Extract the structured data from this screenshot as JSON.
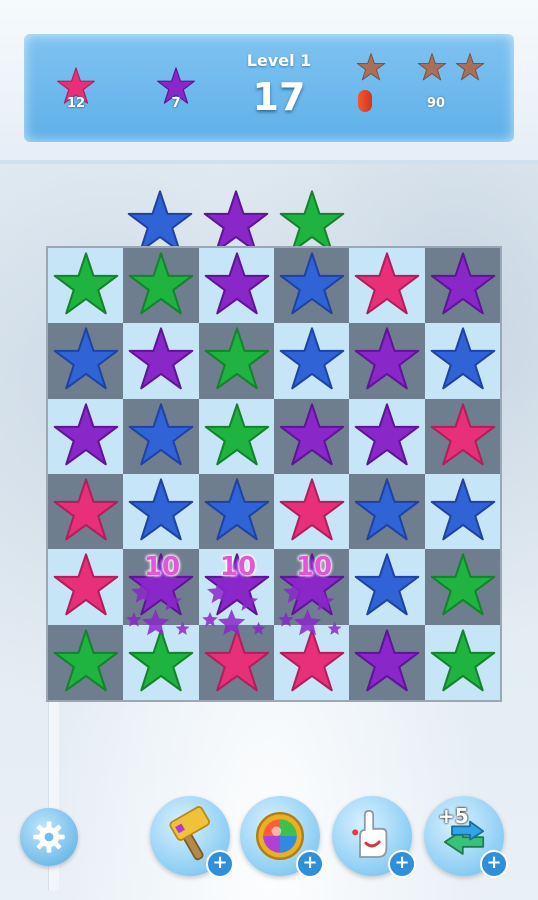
{
  "hud": {
    "level_label": "Level 1",
    "moves_left": "17",
    "score": "90",
    "goals": [
      {
        "icon": "pink-star-goal-icon",
        "color": "#e8307a",
        "count": "12"
      },
      {
        "icon": "purple-star-goal-icon",
        "color": "#8a27c9",
        "count": "7"
      }
    ],
    "rating_stars_earned": 0,
    "rating_stars_total": 3
  },
  "colors": {
    "pink": "#e8307a",
    "purple": "#8a27c9",
    "green": "#1fb33f",
    "blue": "#2f63d6",
    "rating_star": "#a8705a"
  },
  "incoming": [
    "blue",
    "purple",
    "green"
  ],
  "board": [
    [
      "green",
      "green",
      "purple",
      "blue",
      "pink",
      "purple"
    ],
    [
      "blue",
      "purple",
      "green",
      "blue",
      "purple",
      "blue"
    ],
    [
      "purple",
      "blue",
      "green",
      "purple",
      "purple",
      "pink"
    ],
    [
      "pink",
      "blue",
      "blue",
      "pink",
      "blue",
      "blue"
    ],
    [
      "pink",
      "purple",
      "purple",
      "purple",
      "blue",
      "green"
    ],
    [
      "green",
      "green",
      "pink",
      "pink",
      "purple",
      "green"
    ]
  ],
  "combo_points": [
    "10",
    "10",
    "10"
  ],
  "boosters": [
    {
      "name": "hammer-booster-icon"
    },
    {
      "name": "rainbow-ball-booster-icon"
    },
    {
      "name": "glove-booster-icon"
    },
    {
      "name": "extra-moves-booster-icon",
      "label": "+5"
    }
  ]
}
